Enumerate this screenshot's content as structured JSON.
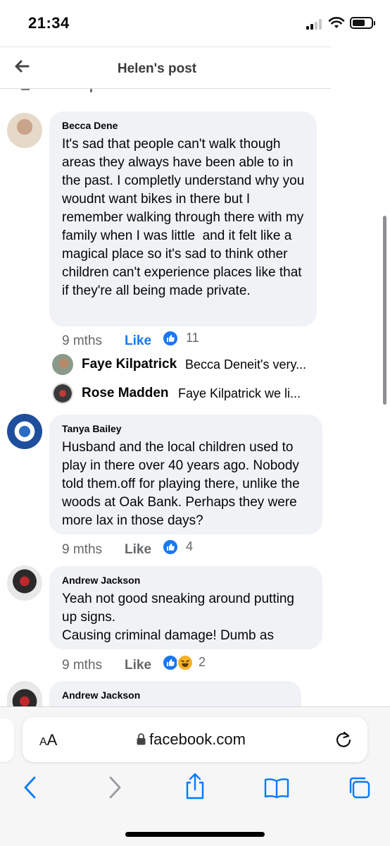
{
  "status_bar": {
    "time": "21:34"
  },
  "header": {
    "title": "Helen's post"
  },
  "comments": [
    {
      "author": "Becca Dene",
      "text": "It's sad that people can't walk though areas they always have been able to in the past. I completly understand why you woudnt want bikes in there but I remember walking through there with my family when I was little  and it felt like a magical place so it's sad to think other children can't experience places like that if they're all being made private.",
      "time": "9 mths",
      "like_label": "Like",
      "reaction_count": "11",
      "replies": [
        {
          "author": "Faye Kilpatrick",
          "preview": "Becca Deneit's very..."
        },
        {
          "author": "Rose Madden",
          "preview": "Faye Kilpatrick we li..."
        }
      ]
    },
    {
      "author": "Tanya Bailey",
      "text": "Husband and the local children used to play in there over 40 years ago. Nobody told them.off for playing there, unlike the woods at Oak Bank. Perhaps they were more lax in those days?",
      "time": "9 mths",
      "like_label": "Like",
      "reaction_count": "4"
    },
    {
      "author": "Andrew Jackson",
      "text": "Yeah not good sneaking around putting up signs.\nCausing criminal damage! Dumb as",
      "time": "9 mths",
      "like_label": "Like",
      "reaction_count": "2"
    },
    {
      "author": "Andrew Jackson"
    }
  ],
  "browser": {
    "text_size_label_small": "A",
    "text_size_label_large": "A",
    "domain": "facebook.com"
  },
  "colors": {
    "accent": "#1877f2",
    "bubble": "#f0f2f5",
    "meta": "#65676b",
    "ios_blue": "#007aff"
  },
  "icons": [
    "back-arrow-icon",
    "wifi-icon",
    "battery-icon",
    "lock-icon",
    "reload-icon",
    "back-icon",
    "forward-icon",
    "share-icon",
    "bookmarks-icon",
    "tabs-icon",
    "like-reaction-icon",
    "haha-reaction-icon"
  ]
}
